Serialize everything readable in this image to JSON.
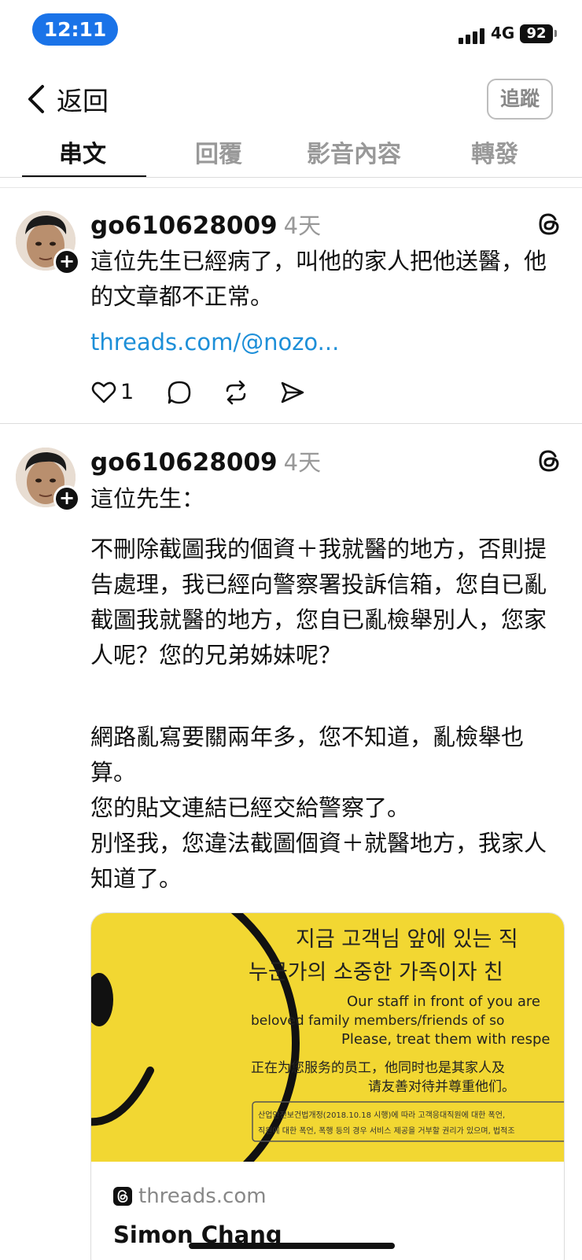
{
  "status_bar": {
    "time": "12:11",
    "network": "4G",
    "battery": "92"
  },
  "nav": {
    "back_label": "返回",
    "follow_label": "追蹤"
  },
  "tabs": [
    {
      "label": "串文",
      "active": true
    },
    {
      "label": "回覆",
      "active": false
    },
    {
      "label": "影音內容",
      "active": false
    },
    {
      "label": "轉發",
      "active": false
    }
  ],
  "posts": [
    {
      "username": "go610628009",
      "time_ago": "4天",
      "text": "這位先生已經病了，叫他的家人把他送醫，他的文章都不正常。",
      "link": "threads.com/@nozo...",
      "like_count": "1"
    },
    {
      "username": "go610628009",
      "time_ago": "4天",
      "paragraphs": [
        "這位先生：",
        "不刪除截圖我的個資＋我就醫的地方，否則提告處理，我已經向警察署投訴信箱，您自已亂截圖我就醫的地方，您自已亂檢舉別人，您家人呢？您的兄弟姊妹呢？",
        "網路亂寫要關兩年多，您不知道，亂檢舉也算。",
        "您的貼文連結已經交給警察了。",
        "別怪我，您違法截圖個資＋就醫地方，我家人知道了。"
      ],
      "card": {
        "image_lines": [
          "지금 고객님 앞에 있는 직",
          "누군가의 소중한 가족이자 친",
          "Our staff in front of you are",
          "beloved family members/friends of so",
          "Please, treat them with respe",
          "正在为您服务的员工，他同时也是其家人及",
          "请友善对待并尊重他们。",
          "산업안전보건법개정(2018.10.18 시행)에 따라 고객응대직원에 대한 폭언,",
          "직원에 대한 폭언, 폭행 등의 경우 서비스 제공을 거부할 권리가 있으며, 법적조"
        ],
        "source": "threads.com",
        "title": "Simon Chang"
      }
    }
  ]
}
